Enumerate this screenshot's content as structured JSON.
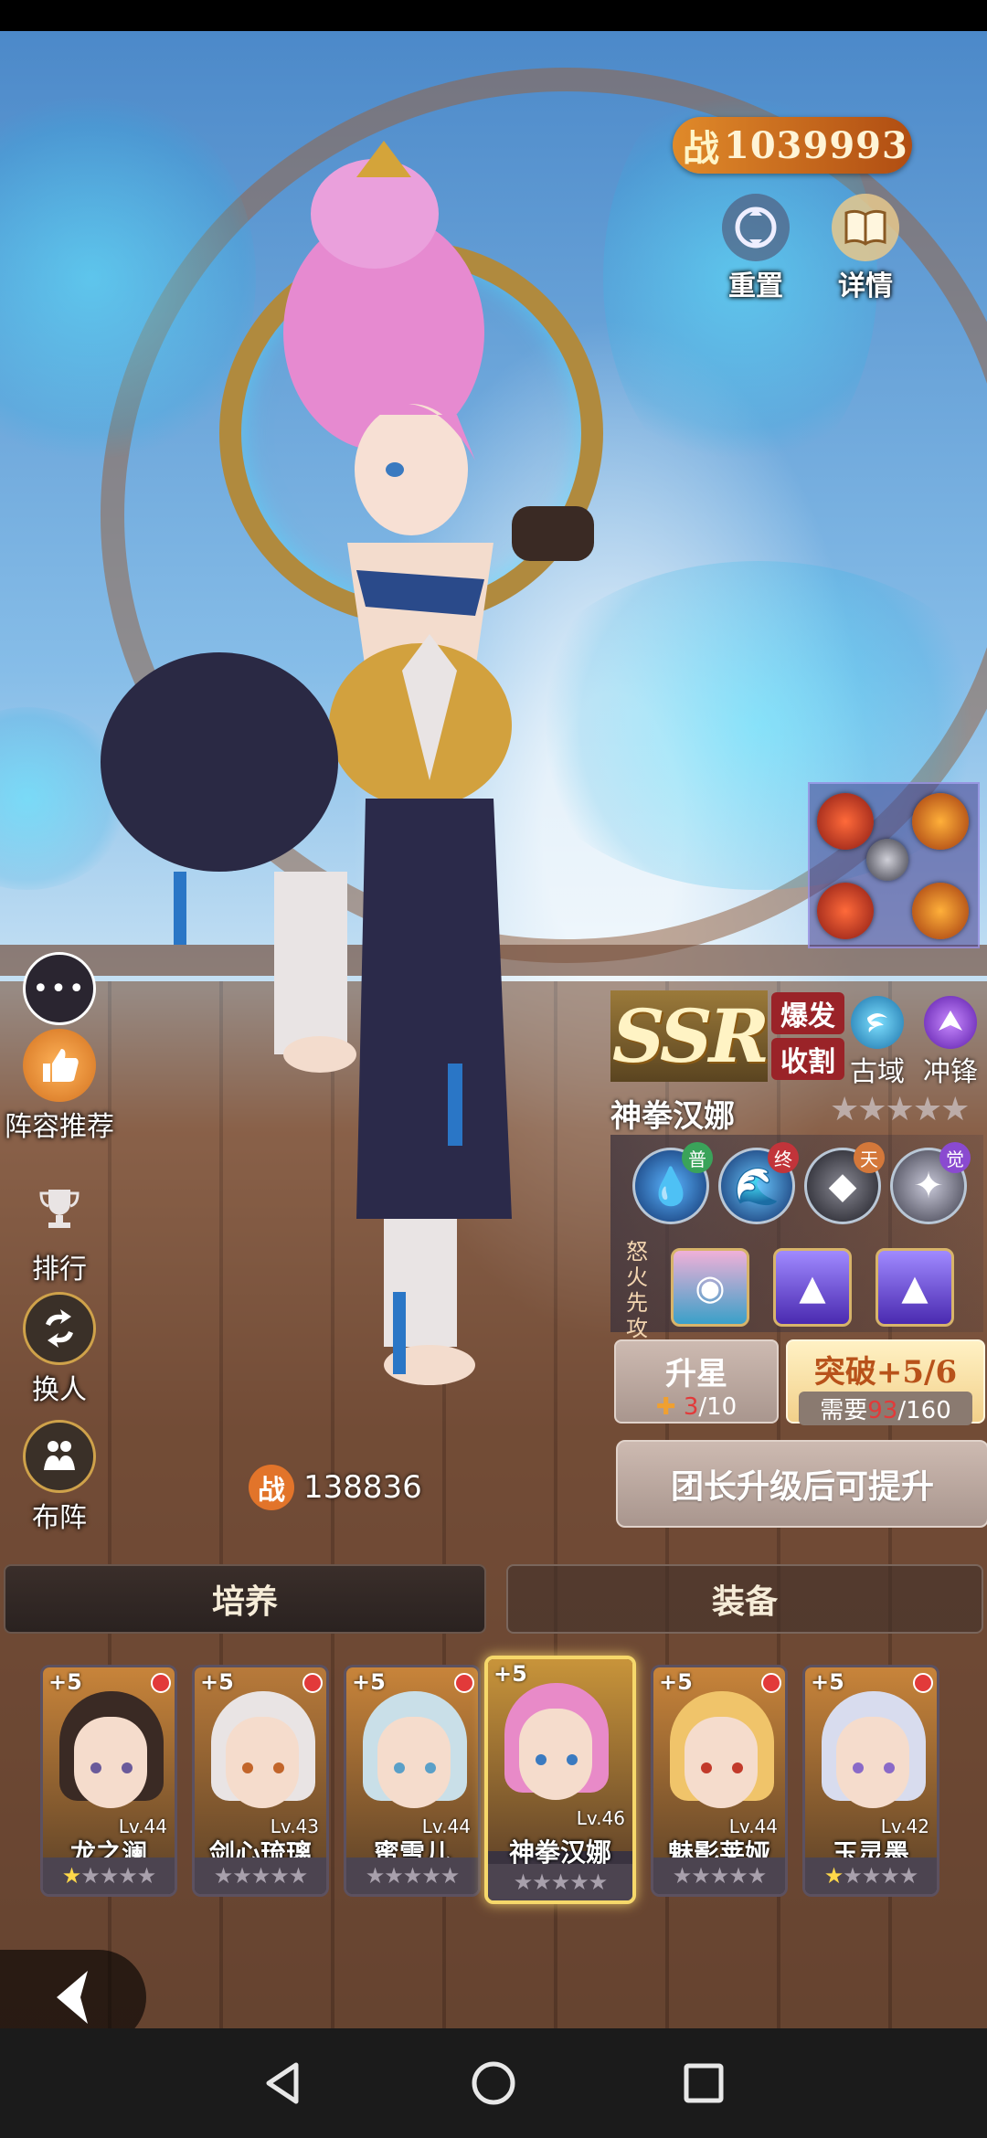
{
  "header": {
    "power_label": "战",
    "power_value": "1039993"
  },
  "top_buttons": [
    {
      "label": "重置",
      "icon": "reset-icon"
    },
    {
      "label": "详情",
      "icon": "book-icon"
    }
  ],
  "left_menu": [
    {
      "label": "",
      "icon": "chat-bubble-icon"
    },
    {
      "label": "阵容推荐",
      "icon": "thumbs-up-icon"
    },
    {
      "label": "排行",
      "icon": "trophy-icon"
    },
    {
      "label": "换人",
      "icon": "swap-icon"
    },
    {
      "label": "布阵",
      "icon": "formation-icon"
    }
  ],
  "team_power": {
    "label": "战",
    "value": "138836"
  },
  "hero": {
    "rarity": "SSR",
    "traits": [
      "爆发",
      "收割"
    ],
    "attributes": [
      {
        "label": "古域",
        "icon": "swirl-icon",
        "color": "#2aa7d8"
      },
      {
        "label": "冲锋",
        "icon": "charge-icon",
        "color": "#8b4ad6"
      }
    ],
    "name": "神拳汉娜",
    "stars_max": 5,
    "stars_filled": 0,
    "skills": [
      {
        "tag": "普",
        "tag_color": "#3aa35a",
        "icon": "water-skill-icon"
      },
      {
        "tag": "终",
        "tag_color": "#c2343a",
        "icon": "water-burst-icon"
      },
      {
        "tag": "天",
        "tag_color": "#d4783a",
        "icon": "dark-skill-icon"
      },
      {
        "tag": "觉",
        "tag_color": "#8a4ad0",
        "icon": "phoenix-icon"
      }
    ],
    "rage_label": "怒火先攻",
    "rage_slots": [
      "portrait-slot-icon",
      "arrow-up-icon",
      "arrow-up-icon"
    ]
  },
  "upgrade": {
    "star_title": "升星",
    "star_current": "3",
    "star_total": "/10",
    "break_title": "突破+5/6",
    "break_need_label": "需要",
    "break_current": "93",
    "break_total": "/160",
    "leader_notice": "团长升级后可提升"
  },
  "tabs": [
    "培养",
    "装备"
  ],
  "roster": [
    {
      "name": "龙之澜",
      "level": "Lv.44",
      "plus": "+5",
      "reddot": true,
      "stars": 1,
      "hair": "#3a2a24",
      "eye": "#6a5a9a",
      "bg": "#c8843a"
    },
    {
      "name": "剑心琉璃",
      "level": "Lv.43",
      "plus": "+5",
      "reddot": true,
      "stars": 0,
      "hair": "#e9e4e4",
      "eye": "#c2652a",
      "bg": "#b87a3a"
    },
    {
      "name": "蜜雪儿",
      "level": "Lv.44",
      "plus": "+5",
      "reddot": true,
      "stars": 0,
      "hair": "#c9dfe8",
      "eye": "#5aa0c8",
      "bg": "#c8843a"
    },
    {
      "name": "神拳汉娜",
      "level": "Lv.46",
      "plus": "+5",
      "reddot": false,
      "stars": 0,
      "hair": "#e88ac8",
      "eye": "#3a7ac0",
      "bg": "#c8943a",
      "selected": true
    },
    {
      "name": "魅影莱娅",
      "level": "Lv.44",
      "plus": "+5",
      "reddot": true,
      "stars": 0,
      "hair": "#f0c46a",
      "eye": "#c23a2a",
      "bg": "#c8843a"
    },
    {
      "name": "玉灵墨",
      "level": "Lv.42",
      "plus": "+5",
      "reddot": true,
      "stars": 1,
      "hair": "#d8dcee",
      "eye": "#8a6ac8",
      "bg": "#c8843a"
    }
  ],
  "colors": {
    "accent": "#e08a2a",
    "ssr_gold": "#fff3c4",
    "trait_red": "#9a2328",
    "highlight": "#f6d86a",
    "need_red": "#e23a3a"
  }
}
